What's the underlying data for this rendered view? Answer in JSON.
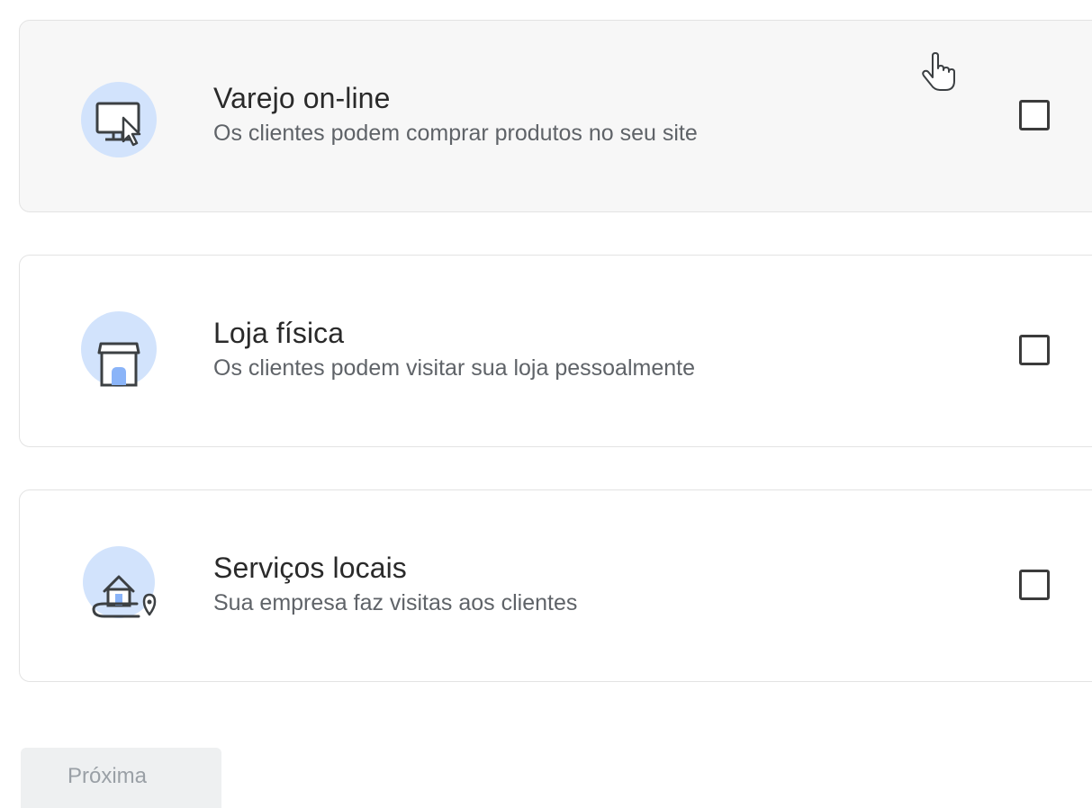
{
  "options": [
    {
      "title": "Varejo on-line",
      "description": "Os clientes podem comprar produtos no seu site",
      "icon": "monitor-cursor-icon",
      "checked": false
    },
    {
      "title": "Loja física",
      "description": "Os clientes podem visitar sua loja pessoalmente",
      "icon": "storefront-icon",
      "checked": false
    },
    {
      "title": "Serviços locais",
      "description": "Sua empresa faz visitas aos clientes",
      "icon": "home-location-icon",
      "checked": false
    }
  ],
  "next_button": {
    "label": "Próxima",
    "disabled": true
  },
  "colors": {
    "icon_circle": "#d2e3fc",
    "icon_stroke": "#3c4043",
    "icon_accent": "#8ab4f8",
    "checkbox_border": "#3b3b3b",
    "card_border": "#e3e3e3",
    "hover_background": "#f7f7f7",
    "title_text": "#2a2a2a",
    "description_text": "#5f6368",
    "button_background": "#eef0f1",
    "button_text": "#9aa0a6"
  }
}
